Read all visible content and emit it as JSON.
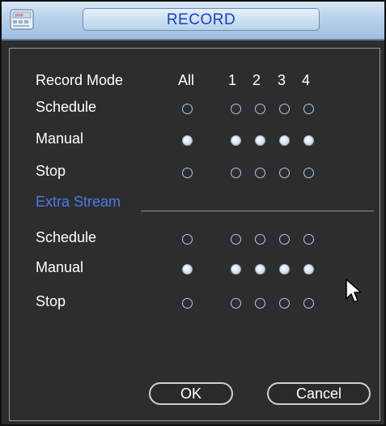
{
  "window": {
    "title": "RECORD"
  },
  "header": {
    "mode_label": "Record Mode",
    "all_label": "All",
    "channels": [
      "1",
      "2",
      "3",
      "4"
    ]
  },
  "main_stream": {
    "rows": [
      {
        "label": "Schedule",
        "all_selected": false,
        "channels_selected": [
          false,
          false,
          false,
          false
        ]
      },
      {
        "label": "Manual",
        "all_selected": true,
        "channels_selected": [
          true,
          true,
          true,
          true
        ]
      },
      {
        "label": "Stop",
        "all_selected": false,
        "channels_selected": [
          false,
          false,
          false,
          false
        ]
      }
    ]
  },
  "extra_stream": {
    "title": "Extra Stream",
    "rows": [
      {
        "label": "Schedule",
        "all_selected": false,
        "channels_selected": [
          false,
          false,
          false,
          false
        ]
      },
      {
        "label": "Manual",
        "all_selected": true,
        "channels_selected": [
          true,
          true,
          true,
          true
        ]
      },
      {
        "label": "Stop",
        "all_selected": false,
        "channels_selected": [
          false,
          false,
          false,
          false
        ]
      }
    ]
  },
  "buttons": {
    "ok": "OK",
    "cancel": "Cancel"
  },
  "icons": {
    "app": "dvr-app-icon",
    "cursor": "mouse-pointer-icon"
  },
  "colors": {
    "title_text": "#1a3fc9",
    "section_text": "#4a7bf0",
    "background": "#2d2d2d"
  }
}
